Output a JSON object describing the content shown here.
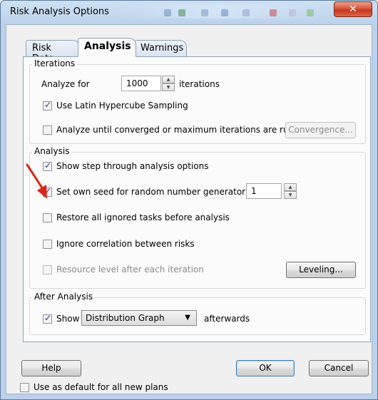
{
  "window": {
    "title": "Risk Analysis Options",
    "close_glyph": "✕"
  },
  "tabs": [
    {
      "label": "Risk Data"
    },
    {
      "label": "Analysis"
    },
    {
      "label": "Warnings"
    }
  ],
  "iterations_group": {
    "label": "Iterations",
    "analyze_for_label": "Analyze for",
    "iterations_value": "1000",
    "iterations_suffix": "iterations",
    "latin_hypercube_label": "Use Latin Hypercube Sampling",
    "converge_label": "Analyze until converged or maximum iterations are run",
    "convergence_button": "Convergence..."
  },
  "analysis_group": {
    "label": "Analysis",
    "step_through_label": "Show step through analysis options",
    "seed_label": "Set own seed for random number generator:",
    "seed_value": "1",
    "restore_label": "Restore all ignored tasks before analysis",
    "ignore_correlation_label": "Ignore correlation between risks",
    "resource_level_label": "Resource level after each iteration",
    "leveling_button": "Leveling..."
  },
  "after_group": {
    "label": "After Analysis",
    "show_label": "Show",
    "dropdown_value": "Distribution Graph",
    "afterwards_label": "afterwards"
  },
  "footer": {
    "help_button": "Help",
    "ok_button": "OK",
    "cancel_button": "Cancel",
    "default_plans_label": "Use as default for all new plans"
  },
  "colors": {
    "annotation_arrow": "#d8261c",
    "accent_check": "#1b3b83"
  }
}
